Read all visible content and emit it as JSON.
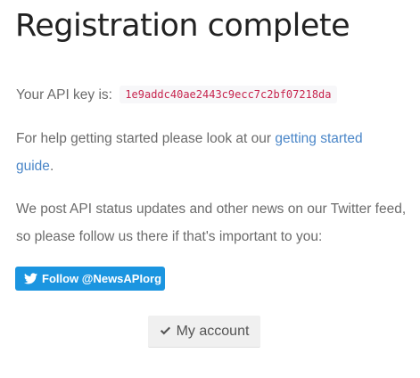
{
  "header": {
    "title": "Registration complete"
  },
  "api": {
    "label": "Your API key is:",
    "key": "1e9addc40ae2443c9ecc7c2bf07218da"
  },
  "help": {
    "text_before": "For help getting started please look at our ",
    "link_text": "getting started guide",
    "text_after": "."
  },
  "news": {
    "text": "We post API status updates and other news on our Twitter feed, so please follow us there if that's important to you:"
  },
  "twitter_button": {
    "label": "Follow @NewsAPIorg",
    "icon": "twitter-bird-icon",
    "color": "#1b95e0"
  },
  "account_button": {
    "label": "My account",
    "icon": "checkmark-icon"
  },
  "colors": {
    "link": "#4a86c8",
    "code_text": "#c7254e",
    "code_bg": "#f7f7f9"
  }
}
